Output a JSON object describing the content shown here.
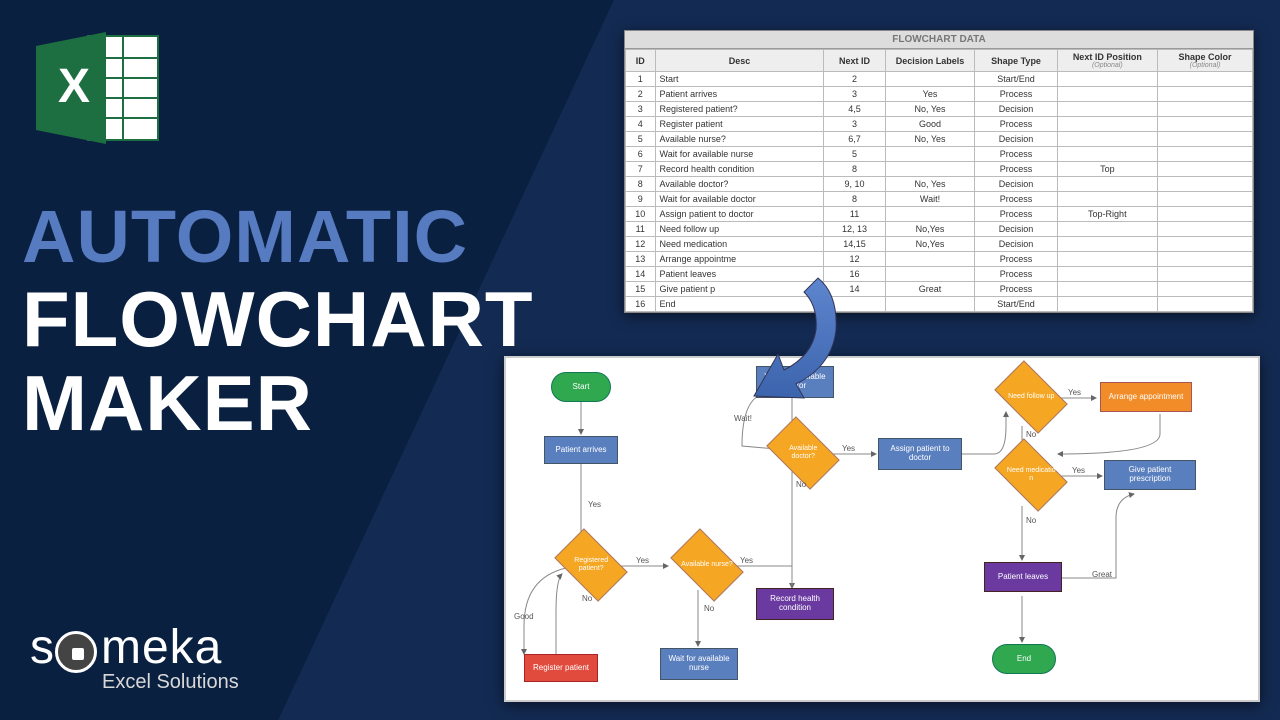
{
  "title": {
    "line1": "AUTOMATIC",
    "line2": "FLOWCHART",
    "line3": "MAKER"
  },
  "brand": {
    "name": "someka",
    "sub": "Excel Solutions"
  },
  "table": {
    "title": "FLOWCHART DATA",
    "headers": {
      "id": "ID",
      "desc": "Desc",
      "next_id": "Next ID",
      "decision_labels": "Decision Labels",
      "shape_type": "Shape Type",
      "next_id_pos": "Next ID Position",
      "next_id_pos_opt": "(Optional)",
      "shape_color": "Shape Color",
      "shape_color_opt": "(Optional)"
    },
    "rows": [
      {
        "id": "1",
        "desc": "Start",
        "next": "2",
        "dec": "",
        "shape": "Start/End",
        "pos": "",
        "col": ""
      },
      {
        "id": "2",
        "desc": "Patient arrives",
        "next": "3",
        "dec": "Yes",
        "shape": "Process",
        "pos": "",
        "col": ""
      },
      {
        "id": "3",
        "desc": "Registered patient?",
        "next": "4,5",
        "dec": "No, Yes",
        "shape": "Decision",
        "pos": "",
        "col": ""
      },
      {
        "id": "4",
        "desc": "Register patient",
        "next": "3",
        "dec": "Good",
        "shape": "Process",
        "pos": "",
        "col": ""
      },
      {
        "id": "5",
        "desc": "Available nurse?",
        "next": "6,7",
        "dec": "No, Yes",
        "shape": "Decision",
        "pos": "",
        "col": ""
      },
      {
        "id": "6",
        "desc": "Wait for available nurse",
        "next": "5",
        "dec": "",
        "shape": "Process",
        "pos": "",
        "col": ""
      },
      {
        "id": "7",
        "desc": "Record health condition",
        "next": "8",
        "dec": "",
        "shape": "Process",
        "pos": "Top",
        "col": ""
      },
      {
        "id": "8",
        "desc": "Available doctor?",
        "next": "9, 10",
        "dec": "No, Yes",
        "shape": "Decision",
        "pos": "",
        "col": ""
      },
      {
        "id": "9",
        "desc": "Wait for available doctor",
        "next": "8",
        "dec": "Wait!",
        "shape": "Process",
        "pos": "",
        "col": ""
      },
      {
        "id": "10",
        "desc": "Assign patient to doctor",
        "next": "11",
        "dec": "",
        "shape": "Process",
        "pos": "Top-Right",
        "col": ""
      },
      {
        "id": "11",
        "desc": "Need follow up",
        "next": "12, 13",
        "dec": "No,Yes",
        "shape": "Decision",
        "pos": "",
        "col": ""
      },
      {
        "id": "12",
        "desc": "Need medication",
        "next": "14,15",
        "dec": "No,Yes",
        "shape": "Decision",
        "pos": "",
        "col": ""
      },
      {
        "id": "13",
        "desc": "Arrange appointme",
        "next": "12",
        "dec": "",
        "shape": "Process",
        "pos": "",
        "col": ""
      },
      {
        "id": "14",
        "desc": "Patient leaves",
        "next": "16",
        "dec": "",
        "shape": "Process",
        "pos": "",
        "col": ""
      },
      {
        "id": "15",
        "desc": "Give patient p",
        "next": "14",
        "dec": "Great",
        "shape": "Process",
        "pos": "",
        "col": ""
      },
      {
        "id": "16",
        "desc": "End",
        "next": "",
        "dec": "",
        "shape": "Start/End",
        "pos": "",
        "col": ""
      }
    ]
  },
  "flowchart": {
    "nodes": {
      "start": "Start",
      "patient_arrives": "Patient arrives",
      "registered": "Registered patient?",
      "register_patient": "Register patient",
      "avail_nurse": "Available nurse?",
      "wait_nurse": "Wait for available nurse",
      "record_health": "Record health condition",
      "avail_doctor": "Available doctor?",
      "wait_doctor": "Wait for available doctor",
      "assign_patient": "Assign patient to doctor",
      "need_followup": "Need follow up",
      "arrange_apt": "Arrange appointment",
      "need_med": "Need medicatio n",
      "give_presc": "Give patient prescription",
      "patient_leaves": "Patient leaves",
      "end": "End"
    },
    "labels": {
      "yes": "Yes",
      "no": "No",
      "good": "Good",
      "wait": "Wait!",
      "great": "Great"
    }
  }
}
